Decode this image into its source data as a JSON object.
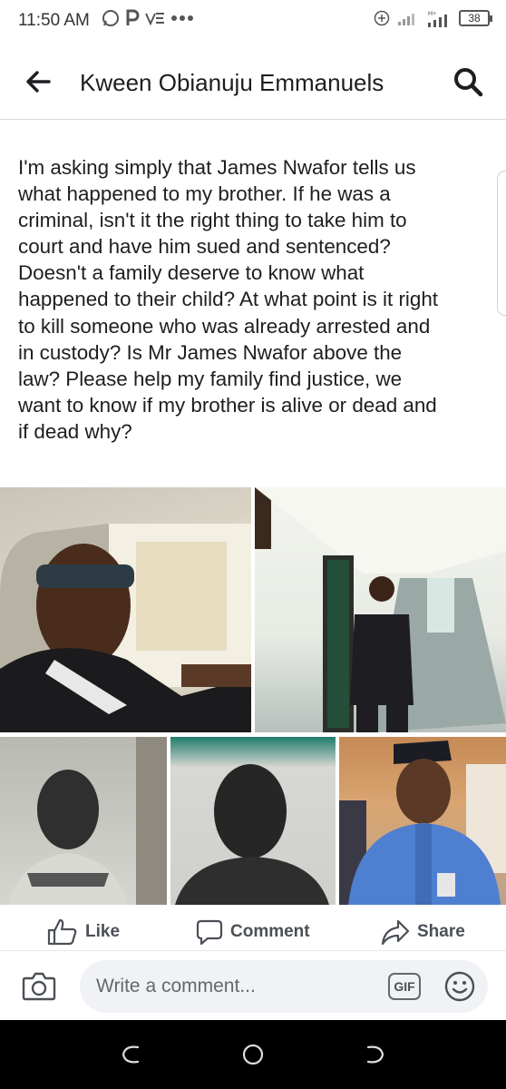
{
  "status_bar": {
    "time": "11:50 AM",
    "battery": "38"
  },
  "header": {
    "title": "Kween Obianuju Emmanuels"
  },
  "post": {
    "body": "I'm asking simply that James Nwafor tells us\nwhat happened to my brother. If he was a\ncriminal, isn't it the right thing to take him to\ncourt and have him sued and sentenced?\nDoesn't a family deserve to know what\nhappened to their child? At what point is it right\nto kill someone who was already arrested and\nin custody? Is Mr James Nwafor above the\nlaw? Please help my family find justice, we\nwant to know if my brother is alive or dead and\nif dead why?"
  },
  "actions": {
    "like": "Like",
    "comment": "Comment",
    "share": "Share"
  },
  "comment_bar": {
    "placeholder": "Write a comment...",
    "gif": "GIF"
  },
  "colors": {
    "text": "#1c1e21",
    "muted": "#65676b",
    "input_bg": "#f0f2f5",
    "nav_bg": "#000000"
  }
}
